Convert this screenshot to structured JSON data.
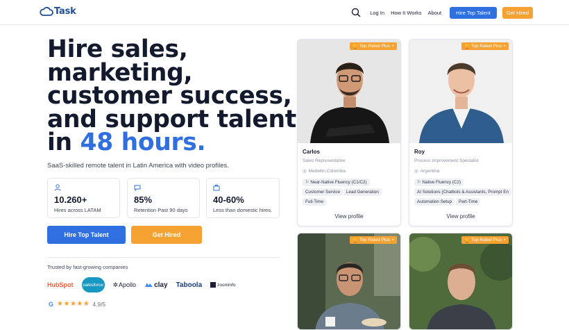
{
  "nav": {
    "logo_prefix": "cloud",
    "logo_text": "Task",
    "links": [
      "Log In",
      "How It Works",
      "About"
    ],
    "primary_cta": "Hire Top Talent",
    "secondary_cta": "Get Hired"
  },
  "hero": {
    "line1": "Hire sales,",
    "line2": "marketing,",
    "line3": "customer success,",
    "line4": "and support talent",
    "line5_prefix": "in ",
    "line5_accent": "48 hours.",
    "subtitle": "SaaS-skilled remote talent in Latin America with video profiles."
  },
  "stats": [
    {
      "icon": "user-icon",
      "value": "10.260+",
      "label": "Hires across LATAM"
    },
    {
      "icon": "chat-icon",
      "value": "85%",
      "label": "Retention Past 90 days"
    },
    {
      "icon": "bag-icon",
      "value": "40-60%",
      "label": "Less than domestic hires."
    }
  ],
  "ctas": {
    "hire": "Hire Top Talent",
    "get_hired": "Get Hired"
  },
  "trusted": {
    "label": "Trusted by fast-growing companies",
    "logos": [
      "HubSpot",
      "salesforce",
      "Apollo",
      "clay",
      "Taboola",
      "zoominfo"
    ]
  },
  "rating": {
    "value": "4.9/5",
    "stars": "★★★★★",
    "google": "G"
  },
  "colors": {
    "accent": "#2f6fe0",
    "orange": "#f6a233",
    "dark": "#141a2e"
  },
  "cards": [
    {
      "badge": "Top Rated Plus",
      "name": "Carlos",
      "role": "Sales Representative",
      "location": "Medellin,Colombia",
      "language": "Near-Native Fluency (C1/C2)",
      "skills": [
        "Customer Service",
        "Lead Generation",
        "Full-Time"
      ],
      "view": "View profile"
    },
    {
      "badge": "Top Rated Plus",
      "name": "Roy",
      "role": "Process Improvement Specialist",
      "location": "Argentina",
      "language": "Native Fluency (C2)",
      "skills": [
        "AI Solutions (Chatbots & Assistants, Prompt En",
        "Automation Setup",
        "Part-Time"
      ],
      "view": "View profile"
    },
    {
      "badge": "Top Rated Plus"
    },
    {
      "badge": "Top Rated Plus"
    }
  ]
}
